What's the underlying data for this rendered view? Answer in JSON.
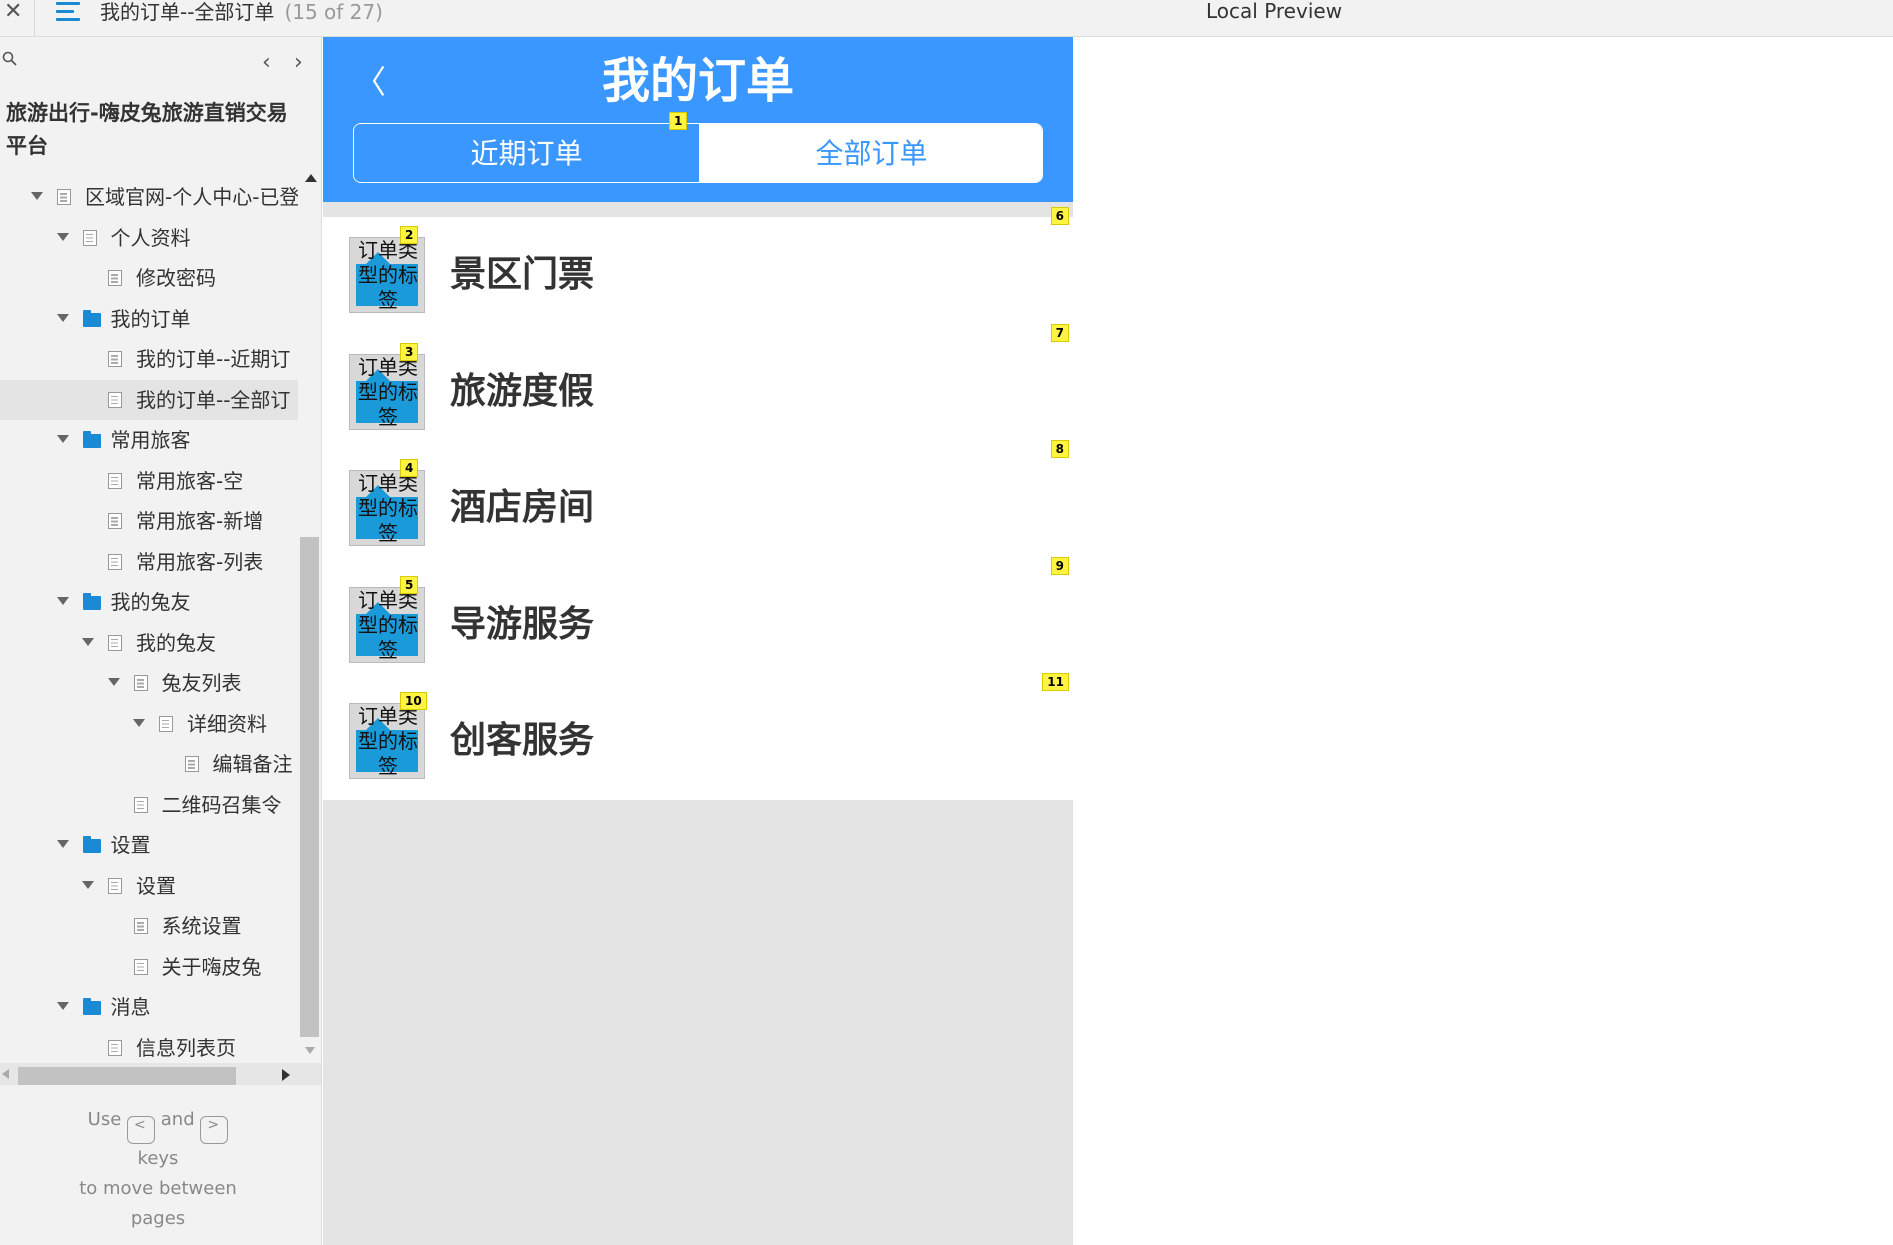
{
  "topbar": {
    "close_glyph": "✕",
    "menu_icon": "hamburger-icon",
    "page_title": "我的订单--全部订单",
    "page_count": "(15 of 27)",
    "preview_label": "Local Preview"
  },
  "sidebar": {
    "prev_glyph": "‹",
    "next_glyph": "›",
    "project_title": "旅游出行-嗨皮兔旅游直销交易平台",
    "tree": [
      {
        "label": "区域官网-个人中心-已登",
        "indent": 0,
        "type": "page",
        "expanded": true
      },
      {
        "label": "个人资料",
        "indent": 1,
        "type": "page",
        "expanded": true
      },
      {
        "label": "修改密码",
        "indent": 2,
        "type": "page"
      },
      {
        "label": "我的订单",
        "indent": 1,
        "type": "folder",
        "expanded": true
      },
      {
        "label": "我的订单--近期订",
        "indent": 2,
        "type": "page"
      },
      {
        "label": "我的订单--全部订",
        "indent": 2,
        "type": "page",
        "selected": true
      },
      {
        "label": "常用旅客",
        "indent": 1,
        "type": "folder",
        "expanded": true
      },
      {
        "label": "常用旅客-空",
        "indent": 2,
        "type": "page"
      },
      {
        "label": "常用旅客-新增",
        "indent": 2,
        "type": "page"
      },
      {
        "label": "常用旅客-列表",
        "indent": 2,
        "type": "page"
      },
      {
        "label": "我的兔友",
        "indent": 1,
        "type": "folder",
        "expanded": true
      },
      {
        "label": "我的兔友",
        "indent": 2,
        "type": "page",
        "expanded": true
      },
      {
        "label": "兔友列表",
        "indent": 3,
        "type": "page",
        "expanded": true
      },
      {
        "label": "详细资料",
        "indent": 4,
        "type": "page",
        "expanded": true
      },
      {
        "label": "编辑备注",
        "indent": 5,
        "type": "page"
      },
      {
        "label": "二维码召集令",
        "indent": 3,
        "type": "page"
      },
      {
        "label": "设置",
        "indent": 1,
        "type": "folder",
        "expanded": true
      },
      {
        "label": "设置",
        "indent": 2,
        "type": "page",
        "expanded": true
      },
      {
        "label": "系统设置",
        "indent": 3,
        "type": "page"
      },
      {
        "label": "关于嗨皮兔",
        "indent": 3,
        "type": "page"
      },
      {
        "label": "消息",
        "indent": 1,
        "type": "folder",
        "expanded": true
      },
      {
        "label": "信息列表页",
        "indent": 2,
        "type": "page"
      }
    ],
    "hint": {
      "use": "Use",
      "prev_key": "<",
      "and": "and",
      "next_key": ">",
      "keys": "keys",
      "line2": "to move between",
      "line3": "pages"
    }
  },
  "phone": {
    "back_glyph": "〈",
    "title": "我的订单",
    "tabs": {
      "recent": "近期订单",
      "all": "全部订单",
      "active": "all"
    },
    "thumb_label": "订单类型的标签",
    "orders": [
      {
        "name": "景区门票",
        "marker": "2",
        "right_marker": "6"
      },
      {
        "name": "旅游度假",
        "marker": "3",
        "right_marker": "7"
      },
      {
        "name": "酒店房间",
        "marker": "4",
        "right_marker": "8"
      },
      {
        "name": "导游服务",
        "marker": "5",
        "right_marker": "9"
      },
      {
        "name": "创客服务",
        "marker": "10",
        "right_marker": "11"
      }
    ],
    "tab_marker": "1"
  },
  "colors": {
    "primary": "#3a97ff",
    "sidebar_bg": "#f2f2f2",
    "marker": "#fff441",
    "folder": "#1a8ad4"
  }
}
